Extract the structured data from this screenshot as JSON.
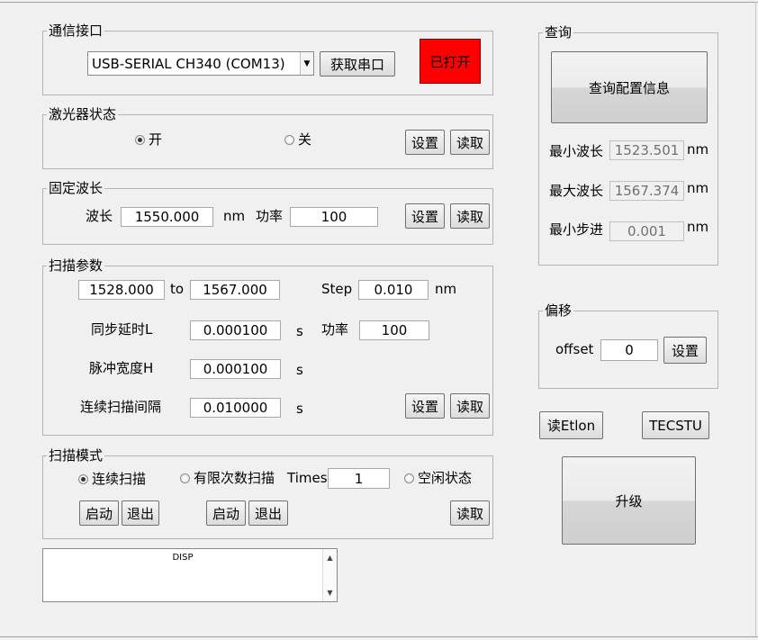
{
  "comm": {
    "title": "通信接口",
    "port_value": "USB-SERIAL CH340 (COM13)",
    "get_port_label": "获取串口",
    "status_label": "已打开",
    "status_color": "#ff0000"
  },
  "laser": {
    "title": "激光器状态",
    "on_label": "开",
    "off_label": "关",
    "selected": "开",
    "set_label": "设置",
    "read_label": "读取"
  },
  "fixed": {
    "title": "固定波长",
    "wavelength_label": "波长",
    "wavelength_value": "1550.000",
    "unit_nm": "nm",
    "power_label": "功率",
    "power_value": "100",
    "set_label": "设置",
    "read_label": "读取"
  },
  "scan": {
    "title": "扫描参数",
    "start_value": "1528.000",
    "to_label": "to",
    "end_value": "1567.000",
    "step_label": "Step",
    "step_value": "0.010",
    "unit_nm": "nm",
    "sync_label": "同步延时L",
    "sync_value": "0.000100",
    "unit_s": "s",
    "power_label": "功率",
    "power_value": "100",
    "pulse_label": "脉冲宽度H",
    "pulse_value": "0.000100",
    "interval_label": "连续扫描间隔",
    "interval_value": "0.010000",
    "set_label": "设置",
    "read_label": "读取"
  },
  "mode": {
    "title": "扫描模式",
    "continuous_label": "连续扫描",
    "limited_label": "有限次数扫描",
    "times_label": "Times",
    "times_value": "1",
    "idle_label": "空闲状态",
    "selected": "连续扫描",
    "start_label": "启动",
    "exit_label": "退出",
    "read_label": "读取"
  },
  "disp": {
    "text": "DISP"
  },
  "query": {
    "title": "查询",
    "query_config_label": "查询配置信息",
    "min_wl_label": "最小波长",
    "min_wl_value": "1523.501",
    "max_wl_label": "最大波长",
    "max_wl_value": "1567.374",
    "min_step_label": "最小步进",
    "min_step_value": "0.001",
    "unit_nm": "nm"
  },
  "offset": {
    "title": "偏移",
    "offset_label": "offset",
    "offset_value": "0",
    "set_label": "设置"
  },
  "misc": {
    "etlon_label": "读Etlon",
    "tecstu_label": "TECSTU",
    "upgrade_label": "升级"
  }
}
